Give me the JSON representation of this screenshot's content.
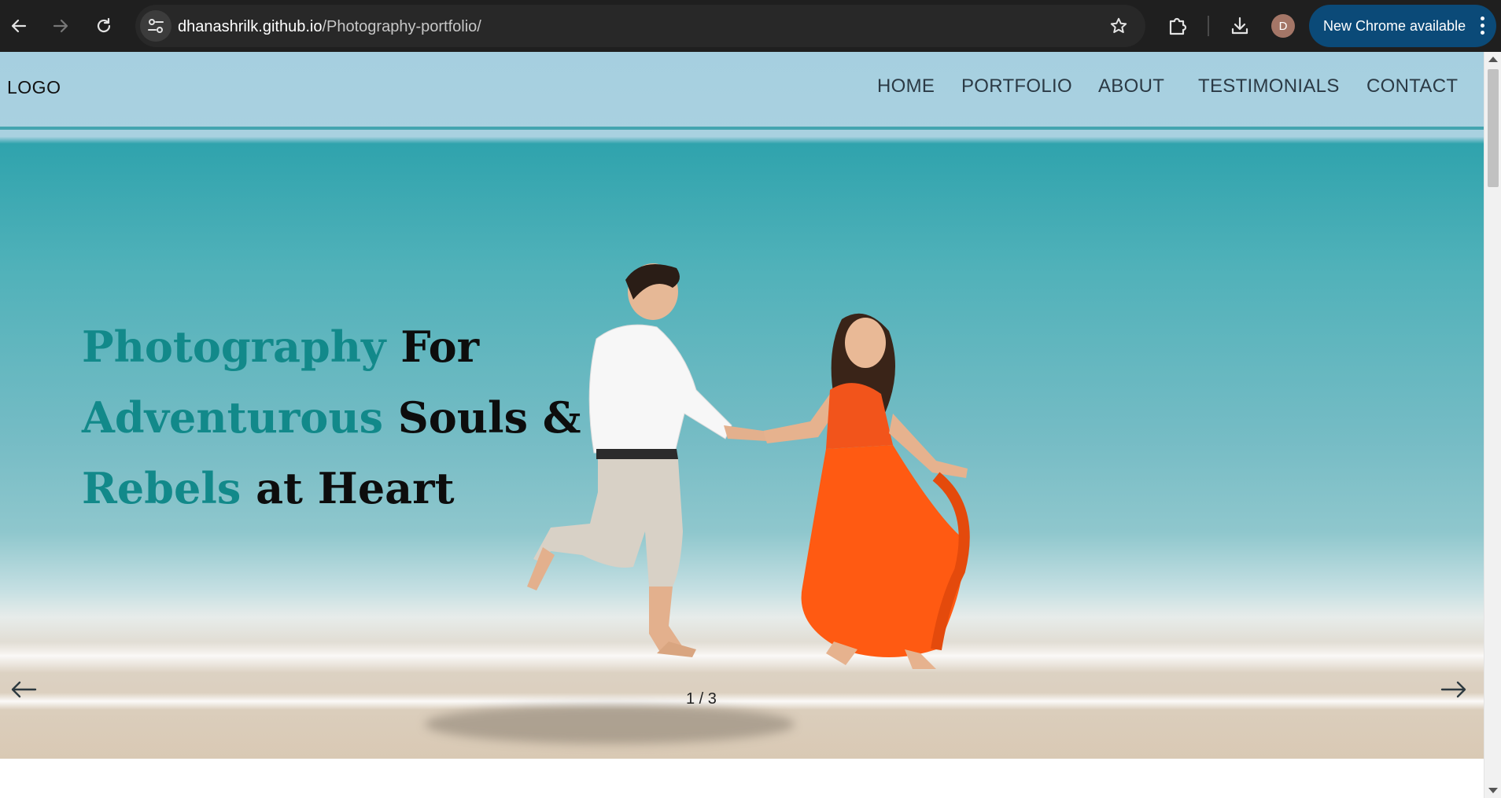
{
  "browser": {
    "url_host": "dhanashrilk.github.io",
    "url_path": "/Photography-portfolio/",
    "profile_initial": "D",
    "update_label": "New Chrome available"
  },
  "site": {
    "logo": "LOGO",
    "nav": [
      "HOME",
      "PORTFOLIO",
      "ABOUT",
      "TESTIMONIALS",
      "CONTACT"
    ]
  },
  "hero": {
    "line1_accent": "Photography",
    "line1_rest": " For",
    "line2_accent": "Adventurous",
    "line2_rest": " Souls &",
    "line3_accent": "Rebels",
    "line3_rest": " at Heart",
    "pager": "1 / 3",
    "accent_color": "#12898a"
  },
  "icons": {
    "back": "back-arrow-icon",
    "forward": "forward-arrow-icon",
    "reload": "reload-icon",
    "site_info": "tune-icon",
    "bookmark": "star-icon",
    "extensions": "puzzle-icon",
    "downloads": "download-icon",
    "prev_slide": "arrow-left-icon",
    "next_slide": "arrow-right-icon"
  }
}
